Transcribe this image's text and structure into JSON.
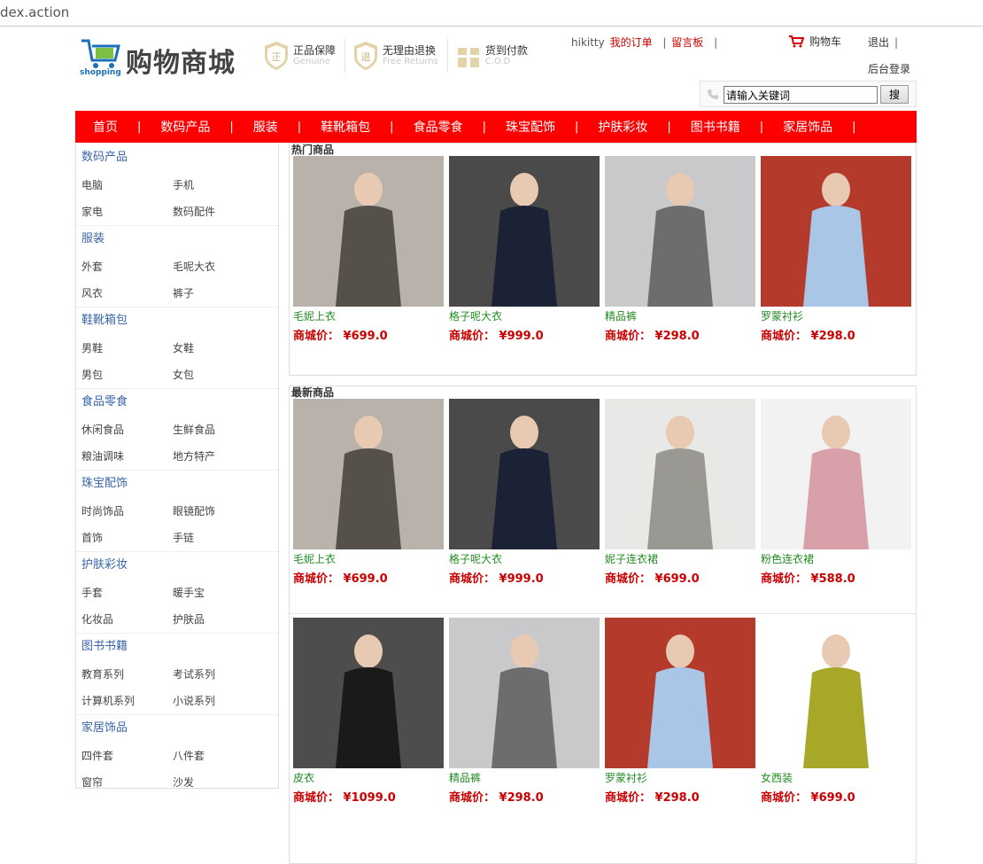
{
  "browser": {
    "url": "dex.action"
  },
  "header": {
    "logo_small": "shopping",
    "logo_text": "购物商城",
    "badges": [
      {
        "title": "正品保障",
        "subtitle": "Genuine",
        "icon": "genuine-seal-icon"
      },
      {
        "title": "无理由退换",
        "subtitle": "Free Returns",
        "icon": "return-seal-icon"
      },
      {
        "title": "货到付款",
        "subtitle": "C.O.D",
        "icon": "cod-gift-icon"
      }
    ],
    "username": "hikitty",
    "my_orders": "我的订单",
    "message_board": "留言板",
    "cart": "购物车",
    "logout": "退出",
    "admin_login": "后台登录",
    "search_value": "请输入关键词",
    "search_button": "搜",
    "separator": "|"
  },
  "nav": [
    "首页",
    "数码产品",
    "服装",
    "鞋靴箱包",
    "食品零食",
    "珠宝配饰",
    "护肤彩妆",
    "图书书籍",
    "家居饰品"
  ],
  "sidebar": [
    {
      "title": "数码产品",
      "items": [
        "电脑",
        "手机",
        "家电",
        "数码配件"
      ]
    },
    {
      "title": "服装",
      "items": [
        "外套",
        "毛呢大衣",
        "风衣",
        "裤子"
      ]
    },
    {
      "title": "鞋靴箱包",
      "items": [
        "男鞋",
        "女鞋",
        "男包",
        "女包"
      ]
    },
    {
      "title": "食品零食",
      "items": [
        "休闲食品",
        "生鲜食品",
        "粮油调味",
        "地方特产"
      ]
    },
    {
      "title": "珠宝配饰",
      "items": [
        "时尚饰品",
        "眼镜配饰",
        "首饰",
        "手链"
      ]
    },
    {
      "title": "护肤彩妆",
      "items": [
        "手套",
        "暖手宝",
        "化妆品",
        "护肤品"
      ]
    },
    {
      "title": "图书书籍",
      "items": [
        "教育系列",
        "考试系列",
        "计算机系列",
        "小说系列"
      ]
    },
    {
      "title": "家居饰品",
      "items": [
        "四件套",
        "八件套",
        "窗帘",
        "沙发"
      ]
    }
  ],
  "hot": {
    "title": "热门商品",
    "products": [
      {
        "name": "毛妮上衣",
        "price": "商城价： ¥699.0",
        "bg": "#b8b2aa",
        "fg": "#555049"
      },
      {
        "name": "格子呢大衣",
        "price": "商城价： ¥999.0",
        "bg": "#4a4a4a",
        "fg": "#1c2236"
      },
      {
        "name": "精品裤",
        "price": "商城价： ¥298.0",
        "bg": "#c9c9cb",
        "fg": "#6d6d70"
      },
      {
        "name": "罗蒙衬衫",
        "price": "商城价： ¥298.0",
        "bg": "#b43a2c",
        "fg": "#a9c6e6"
      }
    ]
  },
  "new": {
    "title": "最新商品",
    "rows": [
      [
        {
          "name": "毛妮上衣",
          "price": "商城价： ¥699.0",
          "bg": "#b8b2aa",
          "fg": "#555049"
        },
        {
          "name": "格子呢大衣",
          "price": "商城价： ¥999.0",
          "bg": "#4a4a4a",
          "fg": "#1c2236"
        },
        {
          "name": "妮子连衣裙",
          "price": "商城价： ¥699.0",
          "bg": "#e8e8e6",
          "fg": "#9a9892"
        },
        {
          "name": "粉色连衣裙",
          "price": "商城价： ¥588.0",
          "bg": "#f2f2f2",
          "fg": "#d8a0a8"
        }
      ],
      [
        {
          "name": "皮衣",
          "price": "商城价： ¥1099.0",
          "bg": "#4d4d4d",
          "fg": "#1a1a1a"
        },
        {
          "name": "精品裤",
          "price": "商城价： ¥298.0",
          "bg": "#c9c9cb",
          "fg": "#6d6d70"
        },
        {
          "name": "罗蒙衬衫",
          "price": "商城价： ¥298.0",
          "bg": "#b43a2c",
          "fg": "#a9c6e6"
        },
        {
          "name": "女西装",
          "price": "商城价： ¥699.0",
          "bg": "#ffffff",
          "fg": "#a8a828"
        }
      ]
    ]
  },
  "colors": {
    "nav_bg": "#ff0000",
    "price": "#cc0000",
    "product_name": "#228b22",
    "category_title": "#3a65a8"
  }
}
